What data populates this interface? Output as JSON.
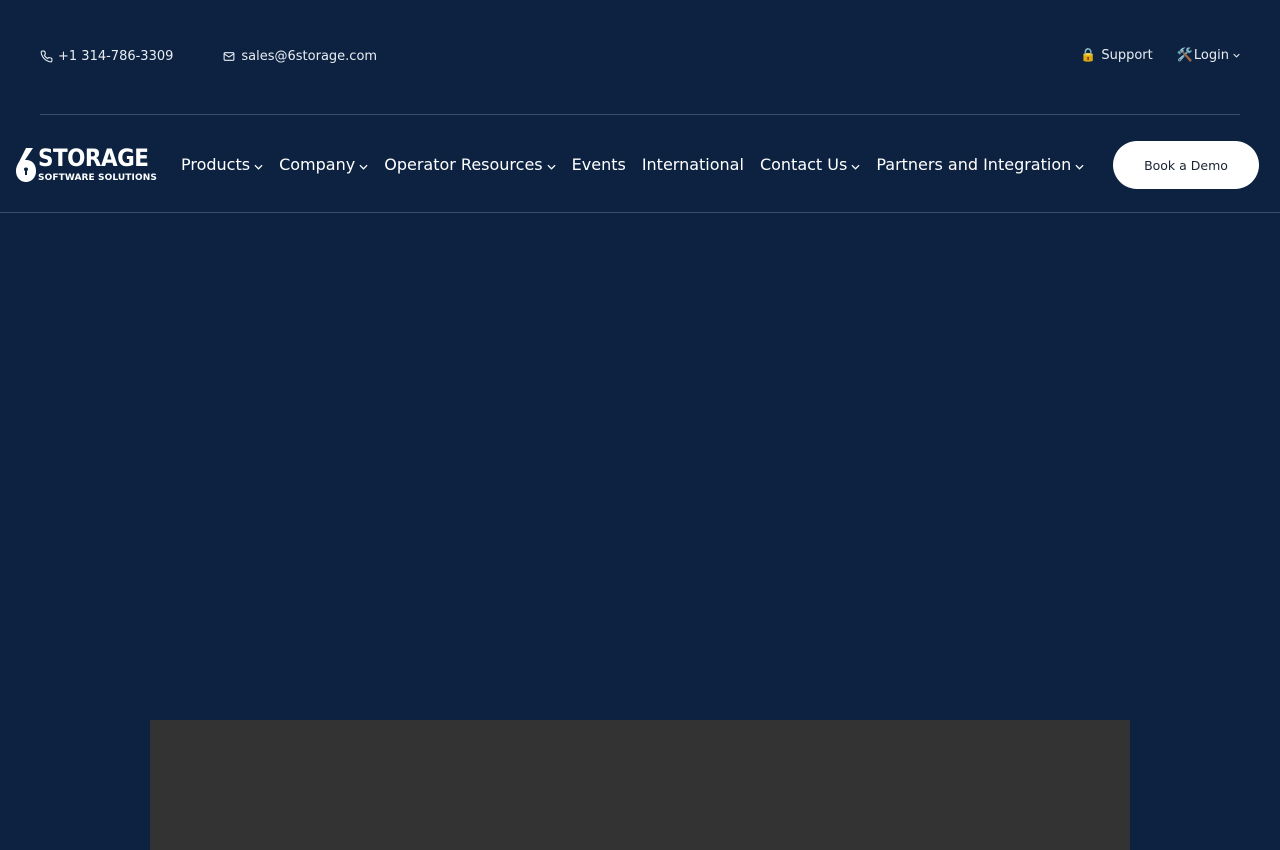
{
  "topbar": {
    "phone": "+1 314-786-3309",
    "email": "sales@6storage.com",
    "support": {
      "icon": "🔒",
      "label": "Support"
    },
    "login": {
      "icon": "🛠️",
      "label": "Login"
    }
  },
  "logo": {
    "big": "STORAGE",
    "small": "SOFTWARE SOLUTIONS"
  },
  "nav": {
    "items": [
      {
        "label": "Products"
      },
      {
        "label": "Company"
      },
      {
        "label": "Operator Resources"
      },
      {
        "label": "Events"
      },
      {
        "label": "International"
      },
      {
        "label": "Contact Us"
      },
      {
        "label": "Partners and Integration"
      }
    ],
    "cta": "Book a Demo"
  },
  "colors": {
    "background": "#0c2240",
    "button_bg": "#ffffff",
    "media_bg": "#333333"
  }
}
